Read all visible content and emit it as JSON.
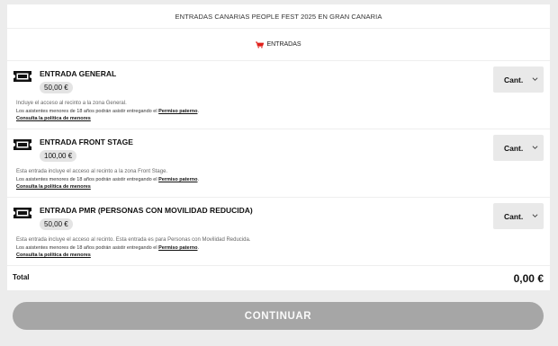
{
  "header": {
    "title": "ENTRADAS CANARIAS PEOPLE FEST 2025 EN GRAN CANARIA"
  },
  "section": {
    "label": "ENTRADAS",
    "icon": "cart-icon",
    "icon_color": "#e0201b"
  },
  "tickets": [
    {
      "name": "ENTRADA GENERAL",
      "price": "50,00 €",
      "description": "Incluye el acceso al recinto a la zona General.",
      "minors_text": "Los asistentes menores de 18 años podrán asistir entregando el ",
      "minors_link": "Permiso paterno",
      "minors_end": ".",
      "policy_link": "Consulta la política de menores",
      "qty_label": "Cant."
    },
    {
      "name": "ENTRADA FRONT STAGE",
      "price": "100,00 €",
      "description": "Esta entrada incluye el acceso al recinto a la zona Front Stage.",
      "minors_text": "Los asistentes menores de 18 años podrán asistir entregando el ",
      "minors_link": "Permiso paterno",
      "minors_end": ".",
      "policy_link": "Consulta la política de menores",
      "qty_label": "Cant."
    },
    {
      "name": "ENTRADA PMR (PERSONAS CON MOVILIDAD REDUCIDA)",
      "price": "50,00 €",
      "description": "Esta entrada incluye el acceso al recinto. Esta entrada es para Personas con Movilidad Reducida.",
      "minors_text": "Los asistentes menores de 18 años podrán asistir entregando el ",
      "minors_link": "Permiso paterno",
      "minors_end": ".",
      "policy_link": "Consulta la política de menores",
      "qty_label": "Cant."
    }
  ],
  "total": {
    "label": "Total",
    "value": "0,00 €"
  },
  "continue_label": "CONTINUAR",
  "colors": {
    "accent": "#e0201b",
    "button_disabled": "#a6a6a6",
    "background": "#ececec"
  }
}
